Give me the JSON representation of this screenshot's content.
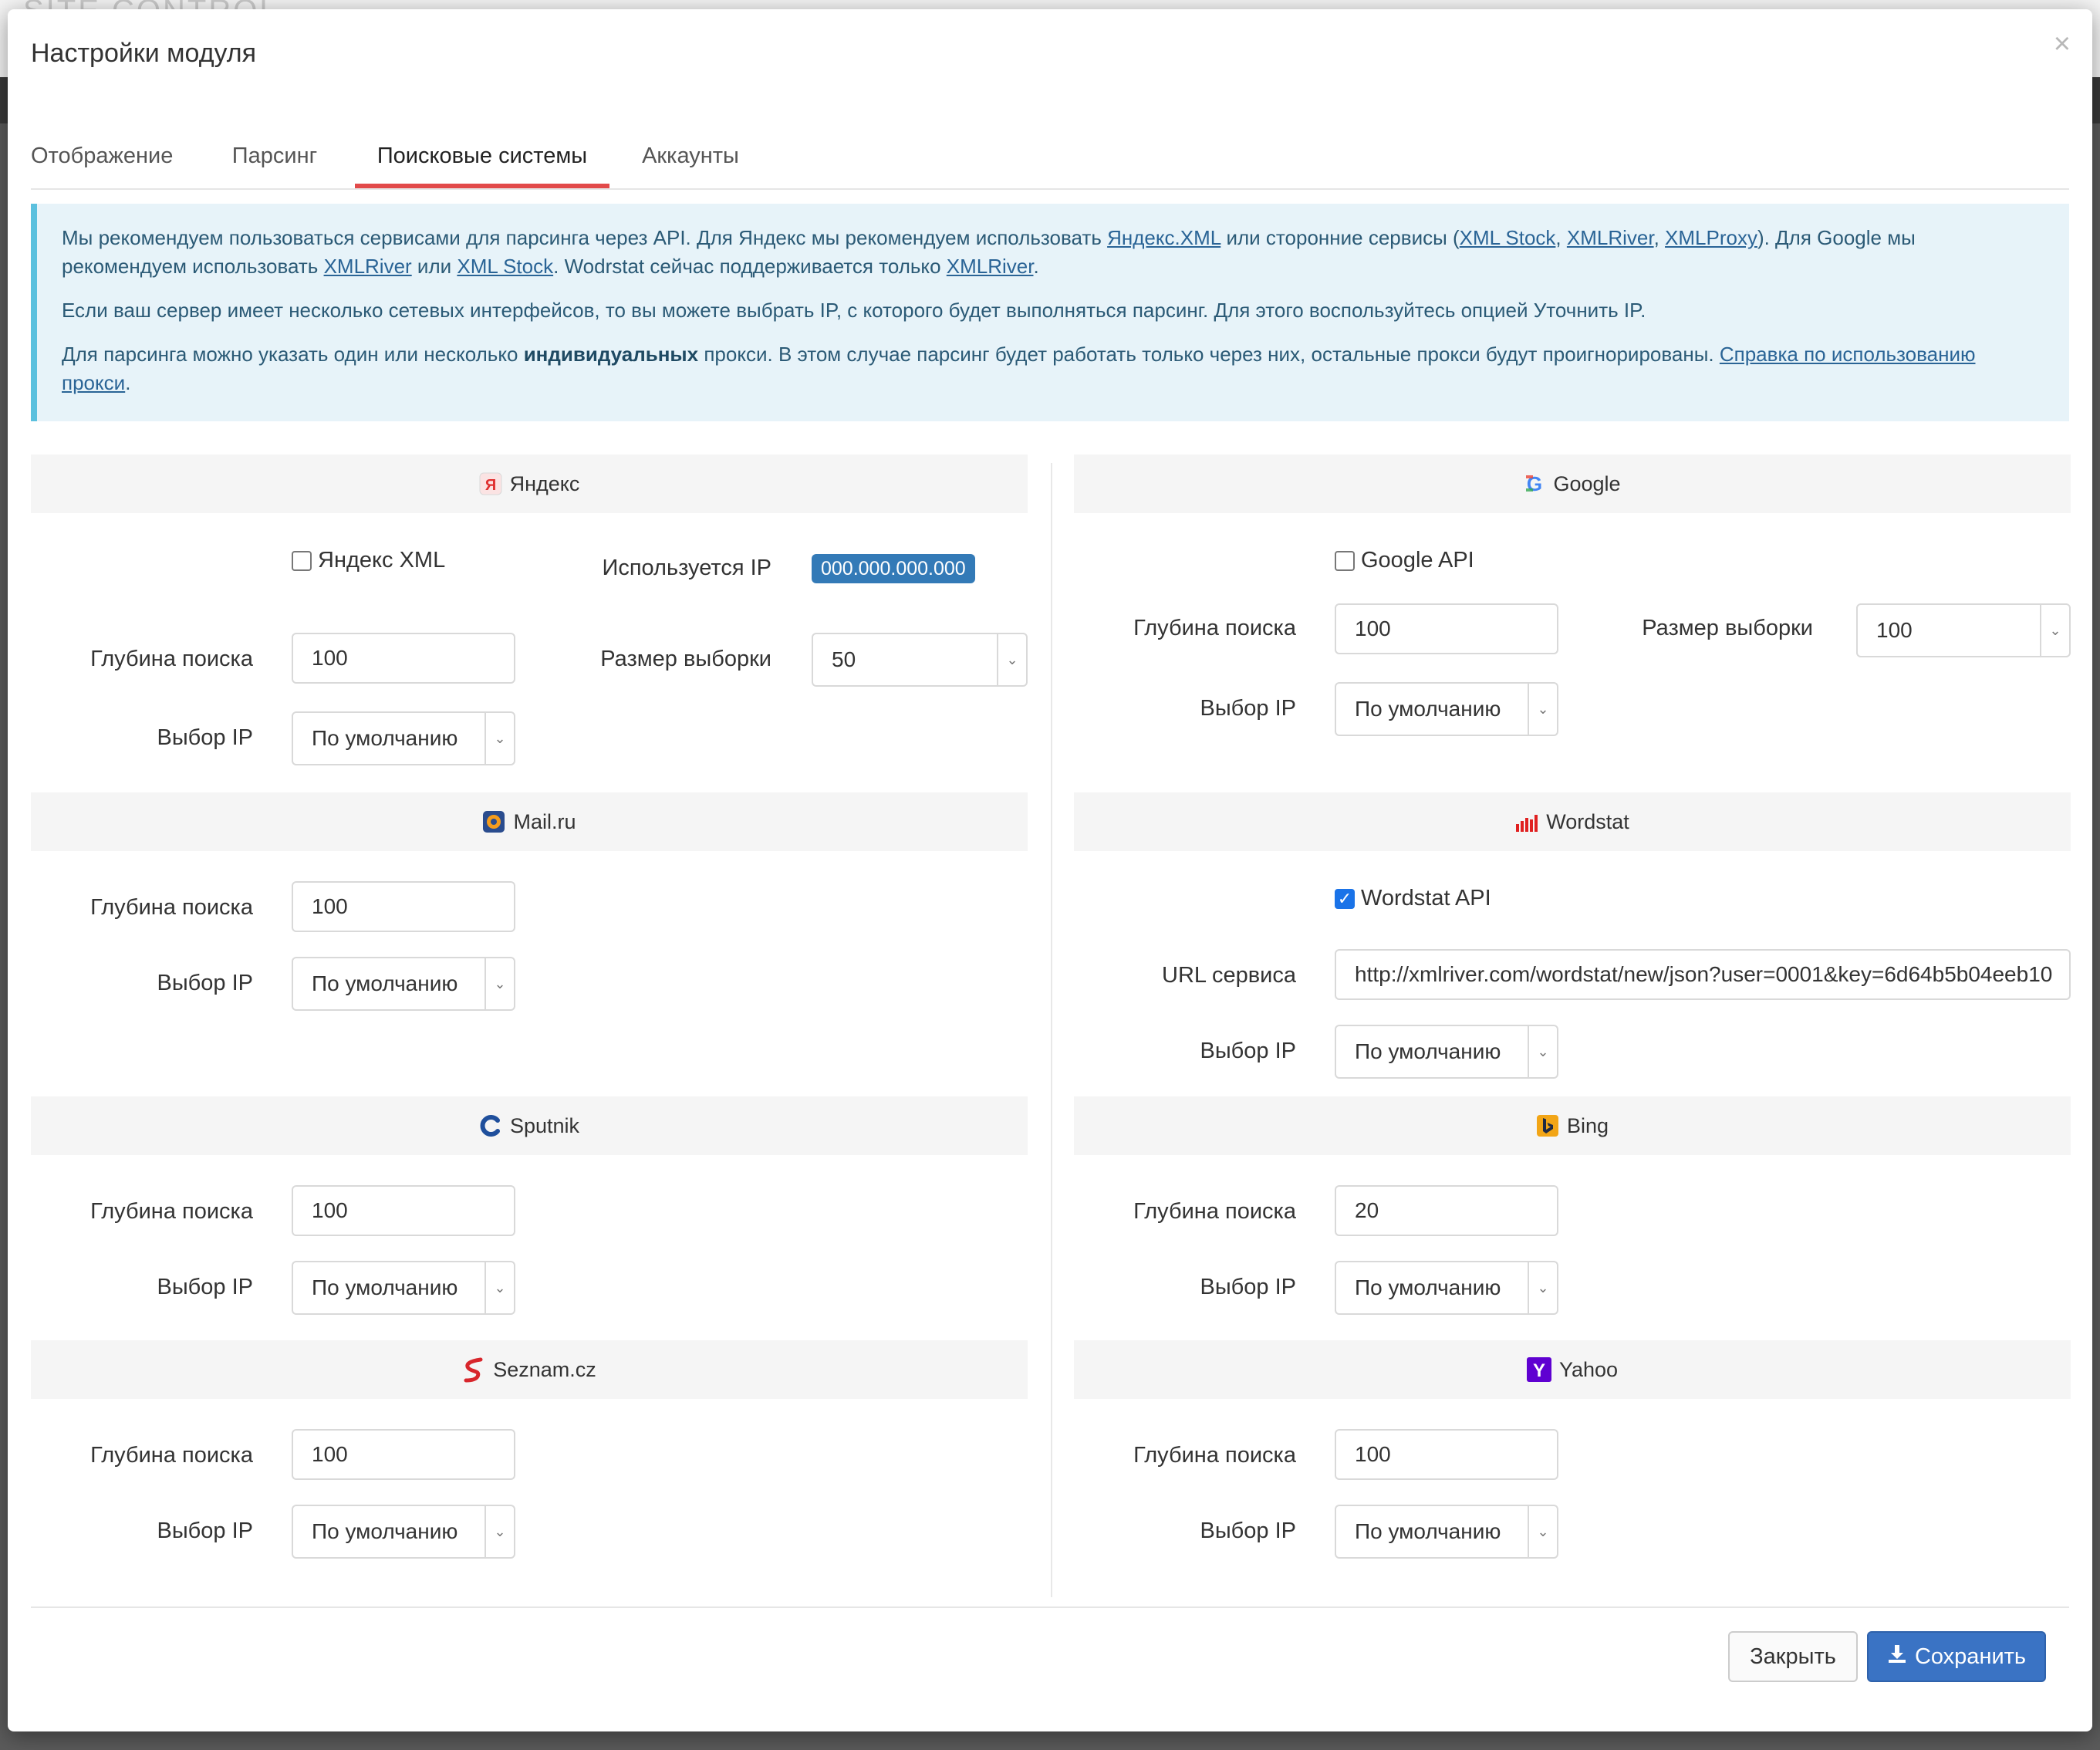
{
  "backdrop": {
    "logo_text": "SITE CONTROL"
  },
  "modal": {
    "title": "Настройки модуля",
    "close_glyph": "×"
  },
  "tabs": [
    {
      "label": "Отображение"
    },
    {
      "label": "Парсинг"
    },
    {
      "label": "Поисковые системы"
    },
    {
      "label": "Аккаунты"
    }
  ],
  "active_tab": "Поисковые системы",
  "alert": {
    "p1": {
      "t1": "Мы рекомендуем пользоваться сервисами для парсинга через API. Для Яндекс мы рекомендуем использовать ",
      "link_yandex_xml": "Яндекс.XML",
      "t2": " или сторонние сервисы (",
      "link_xml_stock": "XML Stock",
      "t3": ", ",
      "link_xmlriver": "XMLRiver",
      "t4": ", ",
      "link_xmlproxy": "XMLProxy",
      "t5": "). Для Google мы рекомендуем использовать ",
      "link_xmlriver2": "XMLRiver",
      "t6": " или ",
      "link_xml_stock2": "XML Stock",
      "t7": ". Wodrstat сейчас поддерживается только ",
      "link_xmlriver3": "XMLRiver",
      "t8": "."
    },
    "p2": "Если ваш сервер имеет несколько сетевых интерфейсов, то вы можете выбрать IP, с которого будет выполняться парсинг. Для этого воспользуйтесь опцией Уточнить IP.",
    "p3": {
      "t1": "Для парсинга можно указать один или несколько ",
      "bold": "индивидуальных",
      "t2": " прокси. В этом случае парсинг будет работать только через них, остальные прокси будут проигнорированы. ",
      "link": "Справка по использованию прокси",
      "t3": "."
    }
  },
  "labels": {
    "depth": "Глубина поиска",
    "ip_select": "Выбор IP",
    "sample_size": "Размер выборки",
    "used_ip": "Используется IP",
    "service_url": "URL сервиса"
  },
  "yandex": {
    "title": "Яндекс",
    "icon": "yandex-icon",
    "xml_label": "Яндекс XML",
    "xml_checked": false,
    "used_ip_value": "000.000.000.000",
    "depth": "100",
    "sample_size": "50",
    "ip": "По умолчанию"
  },
  "google": {
    "title": "Google",
    "icon": "google-icon",
    "api_label": "Google API",
    "api_checked": false,
    "depth": "100",
    "sample_size": "100",
    "ip": "По умолчанию"
  },
  "mailru": {
    "title": "Mail.ru",
    "icon": "mailru-icon",
    "depth": "100",
    "ip": "По умолчанию"
  },
  "wordstat": {
    "title": "Wordstat",
    "icon": "wordstat-icon",
    "api_label": "Wordstat API",
    "api_checked": true,
    "url": "http://xmlriver.com/wordstat/new/json?user=0001&key=6d64b5b04eeb10",
    "ip": "По умолчанию"
  },
  "sputnik": {
    "title": "Sputnik",
    "icon": "sputnik-icon",
    "depth": "100",
    "ip": "По умолчанию"
  },
  "bing": {
    "title": "Bing",
    "icon": "bing-icon",
    "depth": "20",
    "ip": "По умолчанию"
  },
  "seznam": {
    "title": "Seznam.cz",
    "icon": "seznam-icon",
    "depth": "100",
    "ip": "По умолчанию"
  },
  "yahoo": {
    "title": "Yahoo",
    "icon": "yahoo-icon",
    "depth": "100",
    "ip": "По умолчанию"
  },
  "footer": {
    "close_label": "Закрыть",
    "save_label": "Сохранить",
    "save_icon": "download-icon"
  },
  "colors": {
    "accent_tab": "#e24a4a",
    "primary": "#3a73c4",
    "info_bg": "#e7f3f9",
    "info_border": "#5bc0de",
    "checkbox_checked": "#1a73e8"
  }
}
